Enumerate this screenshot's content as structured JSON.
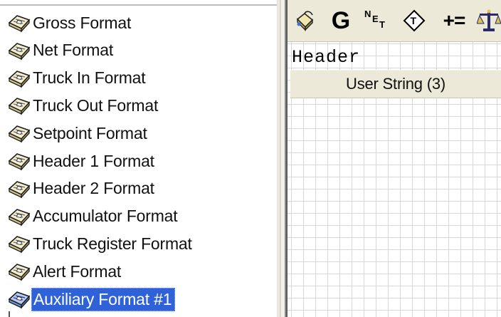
{
  "tree": {
    "items": [
      {
        "label": "Gross Format",
        "icon": "format-book-icon",
        "selected": false
      },
      {
        "label": "Net Format",
        "icon": "format-book-icon",
        "selected": false
      },
      {
        "label": "Truck In Format",
        "icon": "format-book-icon",
        "selected": false
      },
      {
        "label": "Truck Out Format",
        "icon": "format-book-icon",
        "selected": false
      },
      {
        "label": "Setpoint Format",
        "icon": "format-book-icon",
        "selected": false
      },
      {
        "label": "Header 1 Format",
        "icon": "format-book-icon",
        "selected": false
      },
      {
        "label": "Header 2 Format",
        "icon": "format-book-icon",
        "selected": false
      },
      {
        "label": "Accumulator Format",
        "icon": "format-book-icon",
        "selected": false
      },
      {
        "label": "Truck Register Format",
        "icon": "format-book-icon",
        "selected": false
      },
      {
        "label": "Alert Format",
        "icon": "format-book-icon",
        "selected": false
      },
      {
        "label": "Auxiliary Format #1",
        "icon": "format-book-icon",
        "selected": true
      }
    ]
  },
  "toolbar": {
    "buttons": [
      {
        "icon": "paint-bucket-icon"
      },
      {
        "icon": "gross-g-icon",
        "text": "G"
      },
      {
        "icon": "net-icon",
        "text": "NET"
      },
      {
        "icon": "tare-diamond-icon",
        "text": "T"
      },
      {
        "icon": "accumulate-plus-equals-icon",
        "text": "+="
      },
      {
        "icon": "scale-icon"
      }
    ]
  },
  "editor": {
    "header_text": "Header",
    "field_label": "User String (3)"
  },
  "colors": {
    "selection": "#2f62d8",
    "panel": "#ece9d8",
    "grid": "#d7d7d7"
  }
}
